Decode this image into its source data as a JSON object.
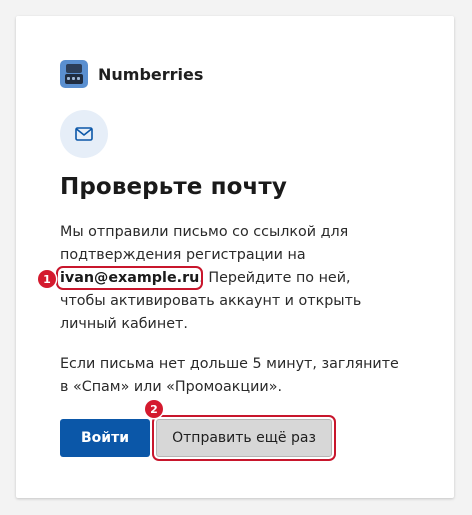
{
  "brand": {
    "name": "Numberries",
    "logo_icon": "calculator-icon",
    "logo_color": "#5a8fd0"
  },
  "mail_icon": "envelope-icon",
  "heading": "Проверьте почту",
  "message": {
    "part1": "Мы отправили письмо со ссылкой для подтверждения регистрации на ",
    "email": "ivan@example.ru",
    "part2": ". Перейдите по ней, чтобы активировать аккаунт и открыть личный кабинет."
  },
  "hint": "Если письма нет дольше 5 минут, загляните в «Спам» или «Промоакции».",
  "actions": {
    "login_label": "Войти",
    "resend_label": "Отправить ещё раз"
  },
  "markers": [
    "1",
    "2"
  ],
  "colors": {
    "primary": "#0b57a8",
    "highlight": "#c8162c",
    "marker": "#d41a2e",
    "badge_bg": "#e6eef8"
  }
}
